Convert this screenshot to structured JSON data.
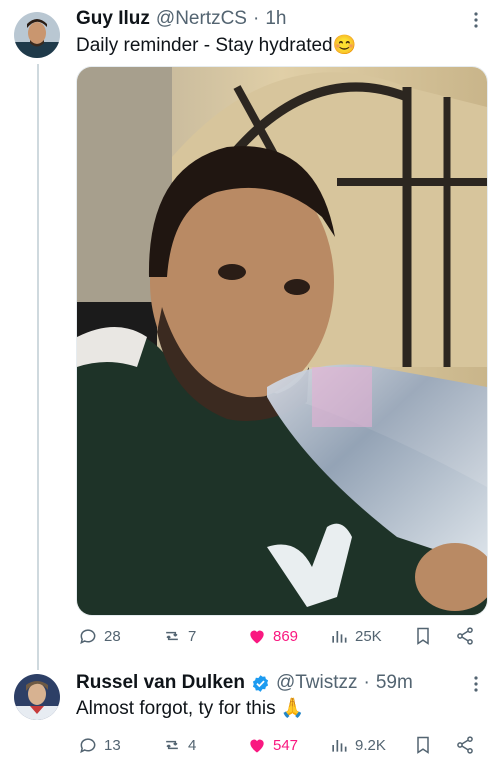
{
  "tweet": {
    "name": "Guy Iluz",
    "handle": "@NertzCS",
    "separator": "·",
    "time": "1h",
    "text": "Daily reminder - Stay hydrated",
    "emoji": "😊",
    "actions": {
      "replies": "28",
      "retweets": "7",
      "likes": "869",
      "views": "25K"
    }
  },
  "reply": {
    "name": "Russel van Dulken",
    "handle": "@Twistzz",
    "separator": "·",
    "time": "59m",
    "text": "Almost forgot, ty for this",
    "emoji": "🙏",
    "actions": {
      "replies": "13",
      "retweets": "4",
      "likes": "547",
      "views": "9.2K"
    }
  },
  "colors": {
    "like": "#f91880",
    "verified": "#1d9bf0",
    "muted": "#536471"
  },
  "icons": [
    "more-icon",
    "reply-icon",
    "retweet-icon",
    "like-icon",
    "views-icon",
    "bookmark-icon",
    "share-icon",
    "verified-icon"
  ]
}
